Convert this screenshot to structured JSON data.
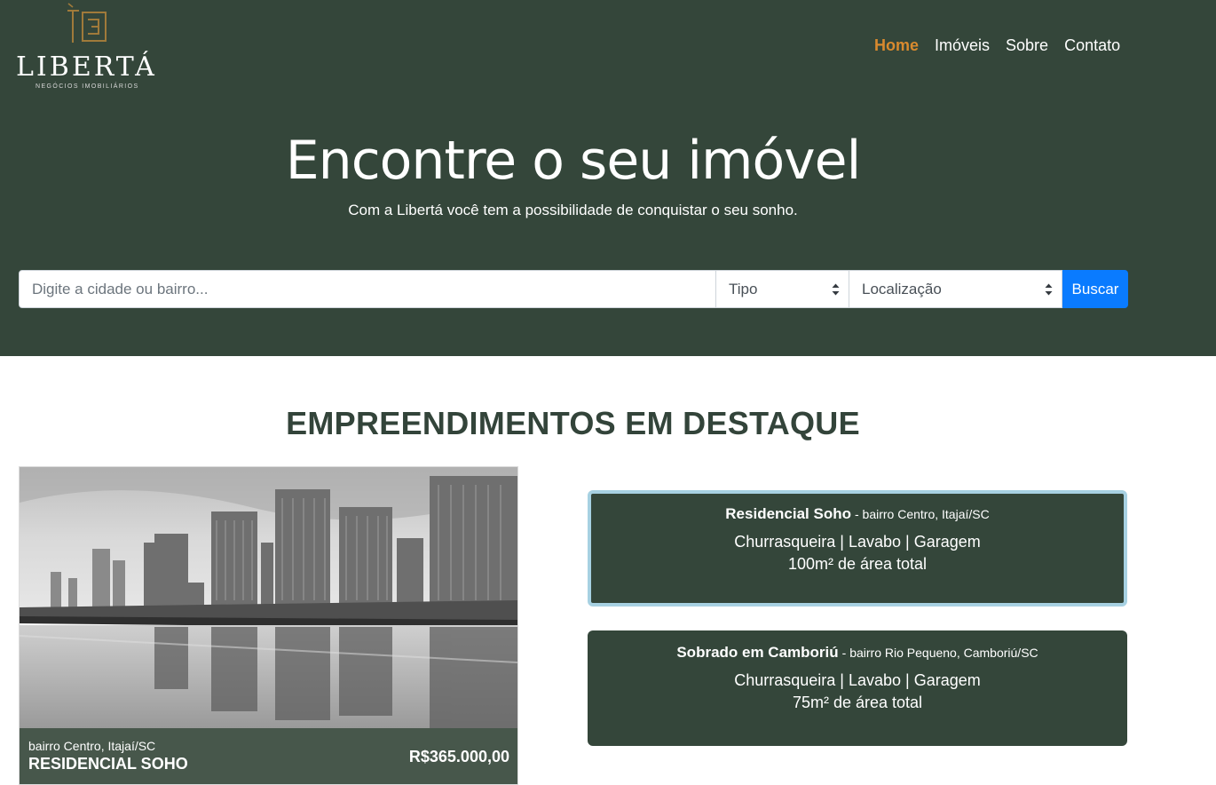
{
  "header": {
    "brand": "LIBERTÁ",
    "tagline": "NEGÓCIOS IMOBILIÁRIOS",
    "nav": [
      {
        "label": "Home",
        "active": true
      },
      {
        "label": "Imóveis",
        "active": false
      },
      {
        "label": "Sobre",
        "active": false
      },
      {
        "label": "Contato",
        "active": false
      }
    ]
  },
  "hero": {
    "title": "Encontre o seu imóvel",
    "subtitle": "Com a Libertá você tem a possibilidade de conquistar o seu sonho."
  },
  "search": {
    "placeholder": "Digite a cidade ou bairro...",
    "type_select": "Tipo",
    "location_select": "Localização",
    "button": "Buscar"
  },
  "featured": {
    "title": "EMPREENDIMENTOS EM DESTAQUE",
    "main": {
      "location": "bairro Centro, Itajaí/SC",
      "name": "RESIDENCIAL SOHO",
      "price": "R$365.000,00"
    },
    "cards": [
      {
        "name": "Residencial Soho",
        "location": "- bairro Centro, Itajaí/SC",
        "features": "Churrasqueira | Lavabo | Garagem",
        "area": "100m² de área total"
      },
      {
        "name": "Sobrado em Camboriú",
        "location": "- bairro Rio Pequeno, Camboriú/SC",
        "features": "Churrasqueira | Lavabo | Garagem",
        "area": "75m² de área total"
      }
    ]
  },
  "colors": {
    "hero_bg": "#34463a",
    "nav_active": "#d98a2e",
    "button": "#0a7bff",
    "card_selected_border": "#a7d1e2",
    "caption_bg": "#47574b"
  }
}
